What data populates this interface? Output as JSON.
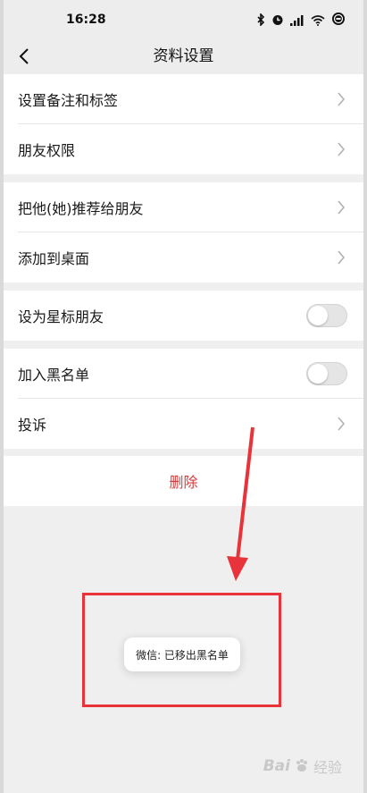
{
  "status_bar": {
    "time": "16:28"
  },
  "nav": {
    "title": "资料设置"
  },
  "groups": [
    {
      "items": [
        {
          "label": "设置备注和标签"
        },
        {
          "label": "朋友权限"
        }
      ]
    },
    {
      "items": [
        {
          "label": "把他(她)推荐给朋友"
        },
        {
          "label": "添加到桌面"
        }
      ]
    },
    {
      "items": [
        {
          "label": "设为星标朋友",
          "toggle_on": false
        }
      ]
    },
    {
      "items": [
        {
          "label": "加入黑名单",
          "toggle_on": false
        },
        {
          "label": "投诉"
        }
      ]
    }
  ],
  "delete_label": "删除",
  "toast": {
    "text": "微信: 已移出黑名单"
  },
  "watermark": {
    "brand": "Bai",
    "suffix": "经验"
  },
  "colors": {
    "danger": "#d43c3c",
    "annotation_red": "#e8333a",
    "background": "#efefef"
  }
}
